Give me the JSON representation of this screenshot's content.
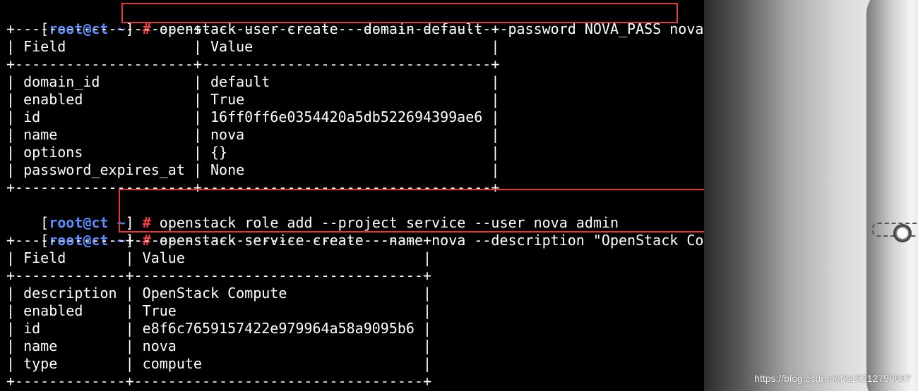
{
  "terminal": {
    "prompt": {
      "open": "[",
      "user_host": "root@ct",
      "path": "~",
      "close": "]",
      "symbol": "#"
    },
    "commands": [
      "openstack user create --domain default --password NOVA_PASS nova",
      "openstack role add --project service --user nova admin",
      "openstack service create --name nova --description \"OpenStack Compute\" compute"
    ],
    "table1": {
      "border_top": "+---------------------+----------------------------------+",
      "header": "| Field               | Value                            |",
      "border_mid": "+---------------------+----------------------------------+",
      "rows": [
        "| domain_id           | default                          |",
        "| enabled             | True                             |",
        "| id                  | 16ff0ff6e0354420a5db522694399ae6 |",
        "| name                | nova                             |",
        "| options             | {}                               |",
        "| password_expires_at | None                             |"
      ],
      "border_bottom": "+---------------------+----------------------------------+"
    },
    "table2": {
      "border_top": "+-------------+----------------------------------+",
      "header": "| Field       | Value                            |",
      "border_mid": "+-------------+----------------------------------+",
      "rows": [
        "| description | OpenStack Compute                |",
        "| enabled     | True                             |",
        "| id          | e8f6c7659157422e979964a58a9095b6 |",
        "| name        | nova                             |",
        "| type        | compute                          |"
      ],
      "border_bottom": "+-------------+----------------------------------+"
    }
  },
  "watermark": "https://blog.csdn.net/s15212790607",
  "colors": {
    "background": "#000000",
    "prompt_user": "#5a8cff",
    "prompt_hash": "#ff4040",
    "highlight_box": "#e03a3a"
  }
}
